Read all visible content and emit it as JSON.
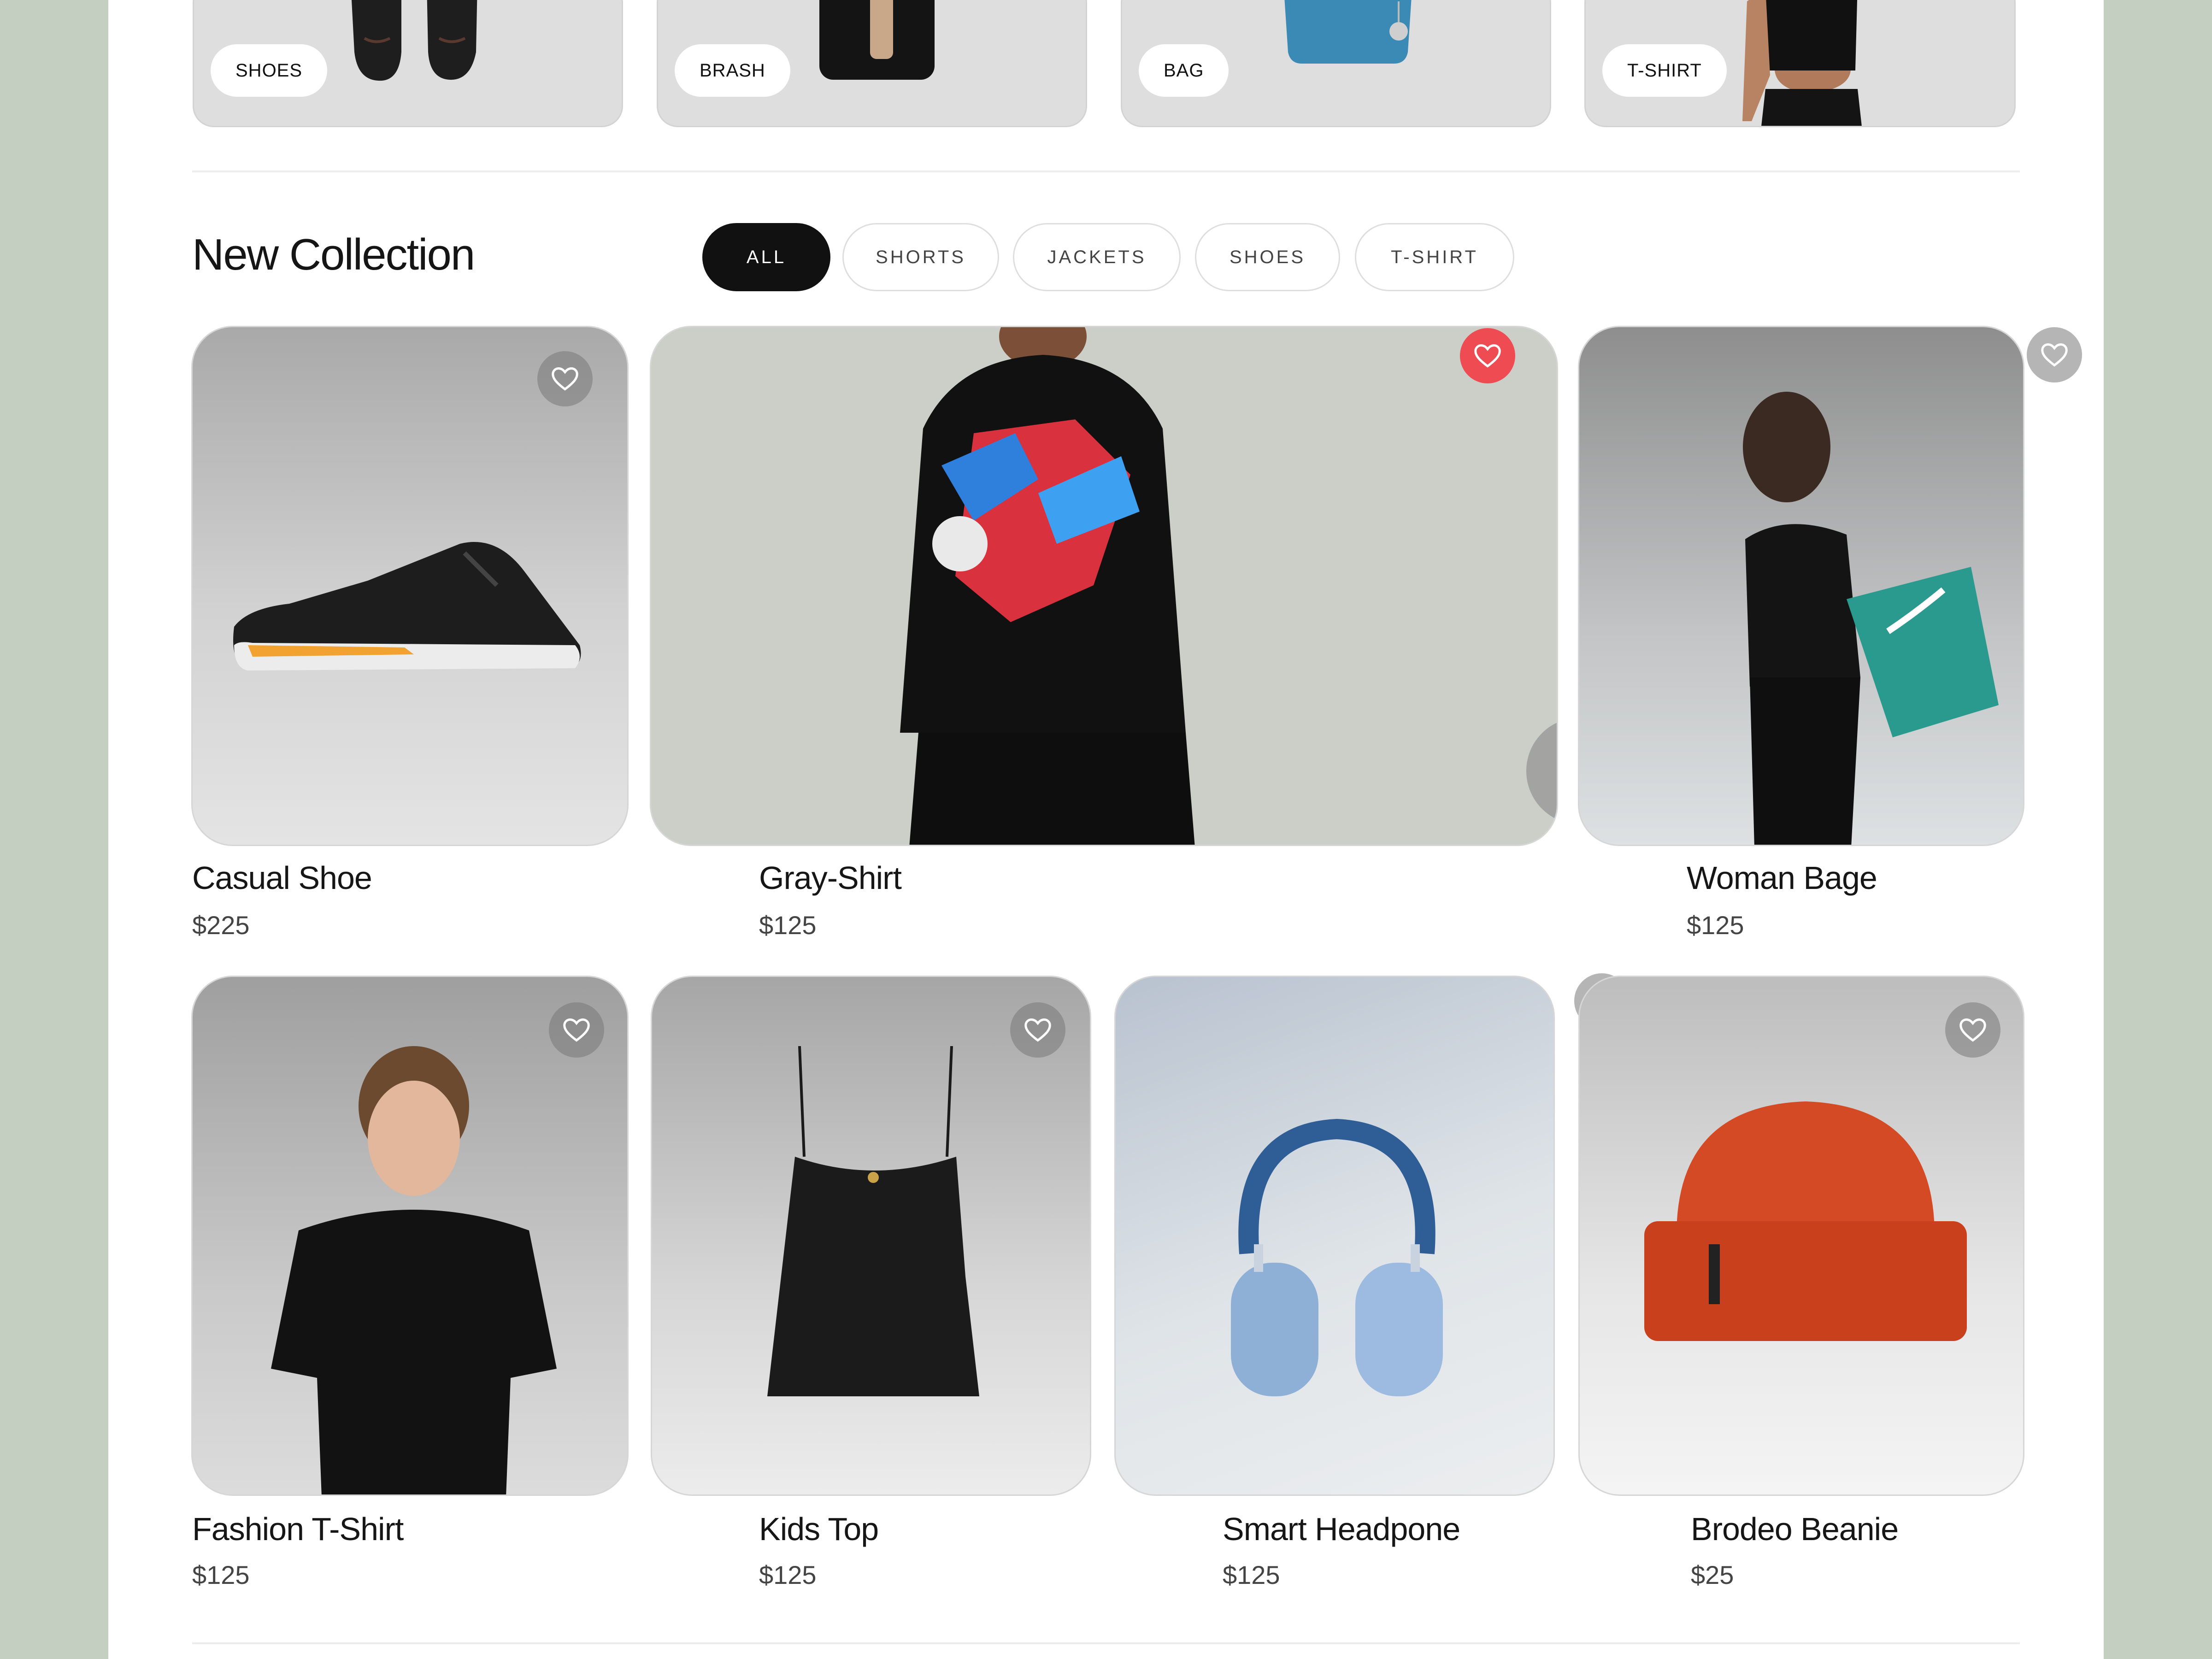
{
  "categories": [
    {
      "label": "SHOES"
    },
    {
      "label": "BRASH"
    },
    {
      "label": "BAG"
    },
    {
      "label": "T-SHIRT"
    }
  ],
  "section": {
    "title": "New Collection"
  },
  "filters": [
    {
      "label": "ALL",
      "active": true
    },
    {
      "label": "SHORTS",
      "active": false
    },
    {
      "label": "JACKETS",
      "active": false
    },
    {
      "label": "SHOES",
      "active": false
    },
    {
      "label": "T-SHIRT",
      "active": false
    }
  ],
  "products": [
    {
      "name": "Casual Shoe",
      "price": "$225",
      "favorite": false
    },
    {
      "name": "Gray-Shirt",
      "price": "$125",
      "favorite": true
    },
    {
      "name": "Woman Bage",
      "price": "$125",
      "favorite": false
    },
    {
      "name": "Fashion T-Shirt",
      "price": "$125",
      "favorite": false
    },
    {
      "name": "Kids Top",
      "price": "$125",
      "favorite": false
    },
    {
      "name": "Smart Headpone",
      "price": "$125",
      "favorite": false
    },
    {
      "name": "Brodeo Beanie",
      "price": "$25",
      "favorite": false
    }
  ],
  "icons": {
    "favorite": "heart-icon",
    "open": "arrow-up-right-icon"
  },
  "colors": {
    "background": "#c4cec1",
    "accent_dark": "#111111",
    "favorite_active": "#ee4b52"
  }
}
